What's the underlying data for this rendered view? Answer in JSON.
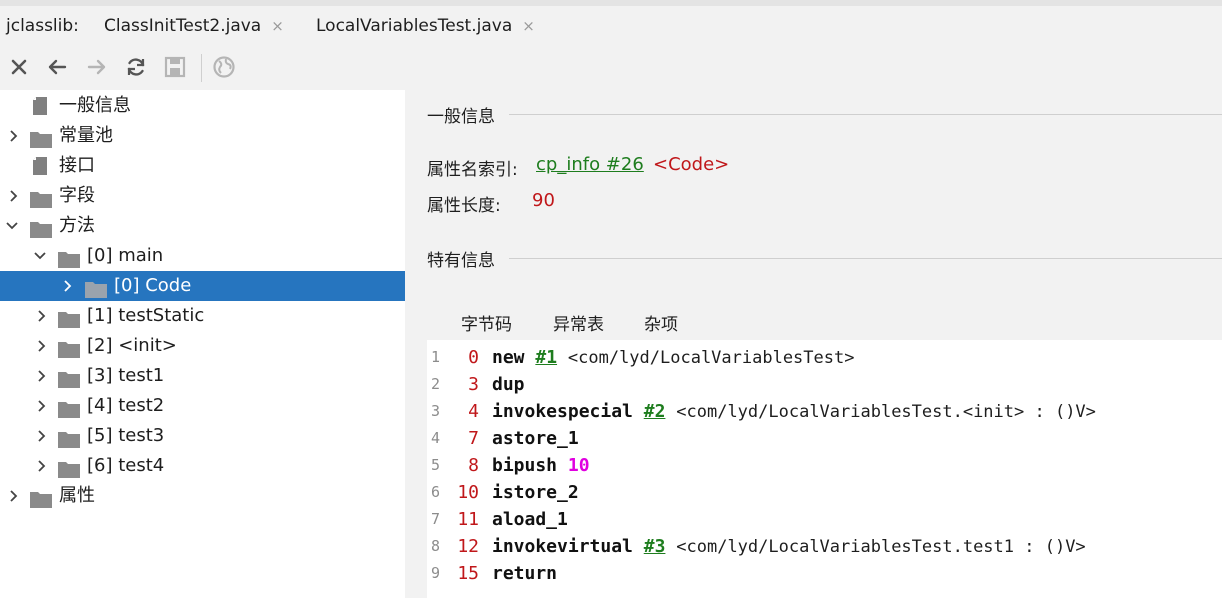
{
  "tabs": {
    "prefix": "jclasslib:",
    "items": [
      {
        "label": "ClassInitTest2.java",
        "close": "×"
      },
      {
        "label": "LocalVariablesTest.java",
        "close": "×"
      }
    ]
  },
  "toolbar": {
    "icons": [
      "close-icon",
      "back-icon",
      "forward-icon",
      "refresh-icon",
      "save-icon",
      "web-icon"
    ]
  },
  "tree": [
    {
      "label": "一般信息"
    },
    {
      "label": "常量池"
    },
    {
      "label": "接口"
    },
    {
      "label": "字段"
    },
    {
      "label": "方法"
    },
    {
      "label": "[0] main"
    },
    {
      "label": "[0] Code"
    },
    {
      "label": "[1] testStatic"
    },
    {
      "label": "[2] <init>"
    },
    {
      "label": "[3] test1"
    },
    {
      "label": "[4] test2"
    },
    {
      "label": "[5] test3"
    },
    {
      "label": "[6] test4"
    },
    {
      "label": "属性"
    }
  ],
  "general": {
    "title": "一般信息",
    "name_index_label": "属性名索引:",
    "name_index_link": "cp_info #26",
    "name_index_value": "<Code>",
    "length_label": "属性长度:",
    "length_value": "90"
  },
  "specific": {
    "title": "特有信息"
  },
  "subtabs": [
    "字节码",
    "异常表",
    "杂项"
  ],
  "bytecode": [
    {
      "line": "1",
      "offset": "0",
      "op": "new",
      "ref": "#1",
      "comment": "<com/lyd/LocalVariablesTest>"
    },
    {
      "line": "2",
      "offset": "3",
      "op": "dup"
    },
    {
      "line": "3",
      "offset": "4",
      "op": "invokespecial",
      "ref": "#2",
      "comment": "<com/lyd/LocalVariablesTest.<init> : ()V>"
    },
    {
      "line": "4",
      "offset": "7",
      "op": "astore_1"
    },
    {
      "line": "5",
      "offset": "8",
      "op": "bipush",
      "num": "10"
    },
    {
      "line": "6",
      "offset": "10",
      "op": "istore_2"
    },
    {
      "line": "7",
      "offset": "11",
      "op": "aload_1"
    },
    {
      "line": "8",
      "offset": "12",
      "op": "invokevirtual",
      "ref": "#3",
      "comment": "<com/lyd/LocalVariablesTest.test1 : ()V>"
    },
    {
      "line": "9",
      "offset": "15",
      "op": "return"
    }
  ],
  "colors": {
    "accent": "#2675bf",
    "tab_underline": "#4a88c7",
    "offset_red": "#c0171a",
    "ref_green": "#1e7d1e",
    "number_magenta": "#e000e0"
  }
}
